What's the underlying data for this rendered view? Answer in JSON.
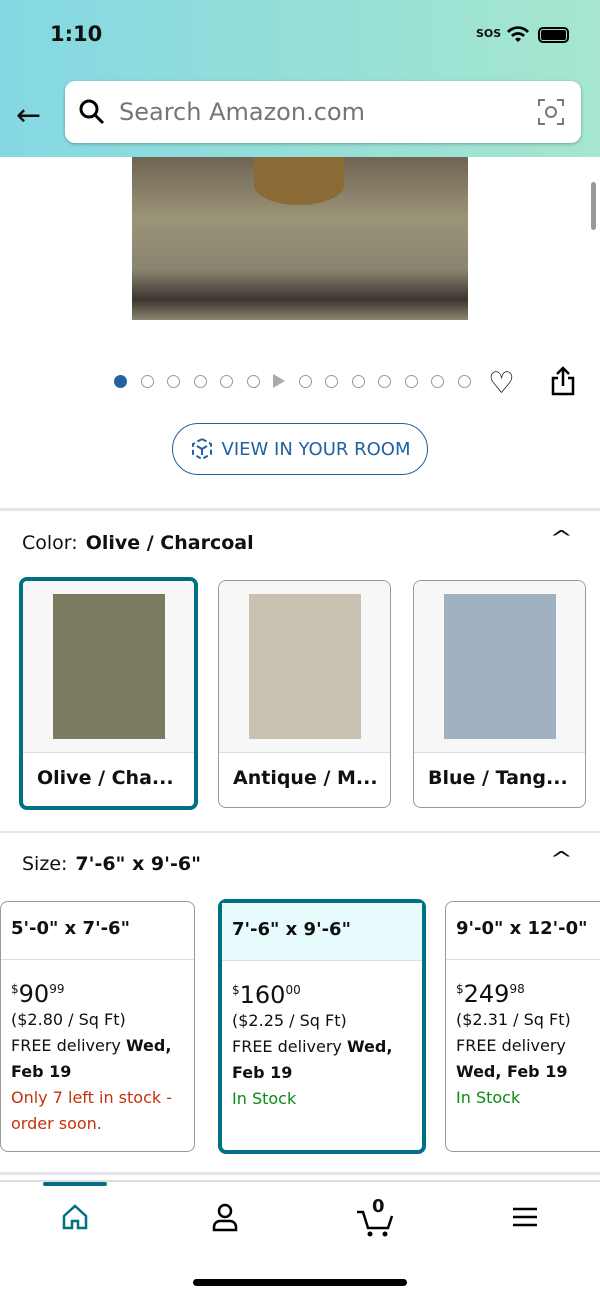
{
  "status": {
    "time": "1:10",
    "sos": "SOS"
  },
  "search": {
    "placeholder": "Search Amazon.com"
  },
  "gallery": {
    "dot_count": 14,
    "active_index": 0,
    "video_index": 6
  },
  "view_in_room": "VIEW IN YOUR ROOM",
  "color": {
    "label": "Color:",
    "selected": "Olive / Charcoal",
    "options": [
      {
        "name": "Olive / Cha...",
        "swatch": "#7d7a62",
        "selected": true
      },
      {
        "name": "Antique / M...",
        "swatch": "#c9c2b2",
        "selected": false
      },
      {
        "name": "Blue / Tang...",
        "swatch": "#9fb1c0",
        "selected": false
      }
    ]
  },
  "size": {
    "label": "Size:",
    "selected": "7'-6\" x 9'-6\"",
    "options": [
      {
        "name": "5'-0\" x 7'-6\"",
        "dollars": "90",
        "cents": "99",
        "currency": "$",
        "per_sqft": "($2.80 / Sq Ft)",
        "delivery": "FREE delivery ",
        "delivery_date": "Wed, Feb 19",
        "stock": "Only 7 left in stock - order soon.",
        "stock_color": "#c4320a"
      },
      {
        "name": "7'-6\" x 9'-6\"",
        "dollars": "160",
        "cents": "00",
        "currency": "$",
        "per_sqft": "($2.25 / Sq Ft)",
        "delivery": "FREE delivery ",
        "delivery_date": "Wed, Feb 19",
        "stock": "In Stock",
        "stock_color": "#0a8a19"
      },
      {
        "name": "9'-0\" x 12'-0\"",
        "dollars": "249",
        "cents": "98",
        "currency": "$",
        "per_sqft": "($2.31 / Sq Ft)",
        "delivery": "FREE delivery ",
        "delivery_date": "Wed, Feb 19",
        "stock": "In Stock",
        "stock_color": "#0a8a19"
      }
    ]
  },
  "nav": {
    "cart_count": "0",
    "active": "home"
  },
  "colors": {
    "accent": "#007185",
    "link": "#2162a1"
  }
}
